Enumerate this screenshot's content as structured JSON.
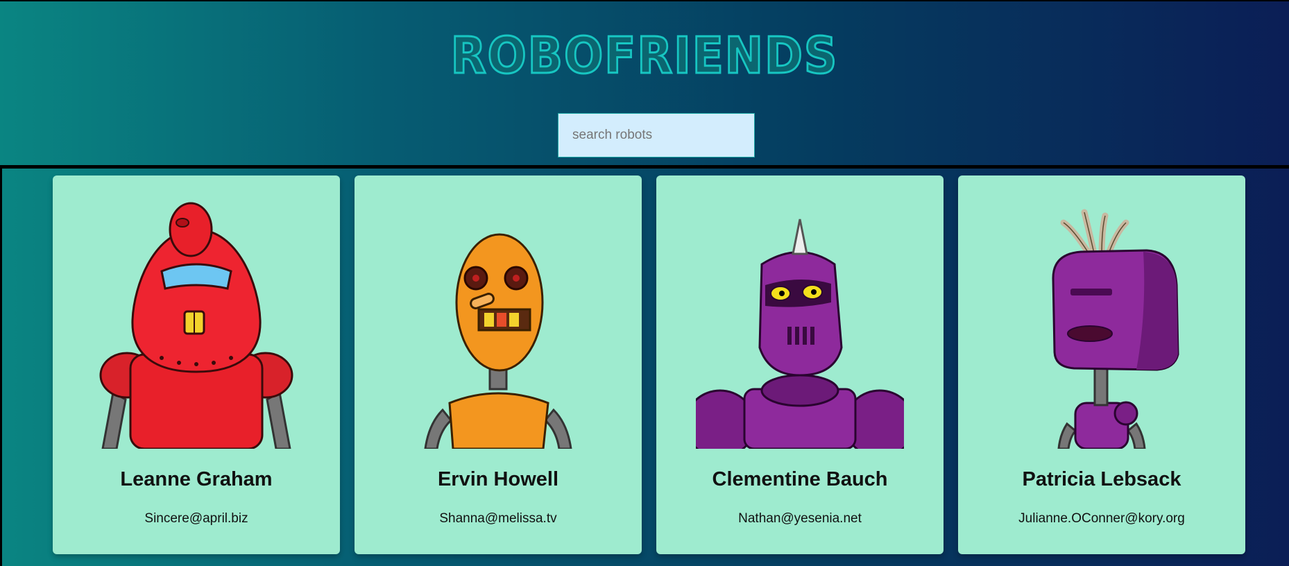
{
  "header": {
    "title": "ROBOFRIENDS",
    "search_placeholder": "search robots",
    "search_value": ""
  },
  "colors": {
    "logo": "#17c6c2",
    "search_bg": "#d3edfd",
    "card_bg": "#9eebcf",
    "bg_start": "#0a8582",
    "bg_end": "#0b1e56"
  },
  "robots": [
    {
      "name": "Leanne Graham",
      "email": "Sincere@april.biz",
      "icon": "red-robot-icon"
    },
    {
      "name": "Ervin Howell",
      "email": "Shanna@melissa.tv",
      "icon": "orange-robot-icon"
    },
    {
      "name": "Clementine Bauch",
      "email": "Nathan@yesenia.net",
      "icon": "purple-robot-icon"
    },
    {
      "name": "Patricia Lebsack",
      "email": "Julianne.OConner@kory.org",
      "icon": "purple-box-robot-icon"
    }
  ]
}
